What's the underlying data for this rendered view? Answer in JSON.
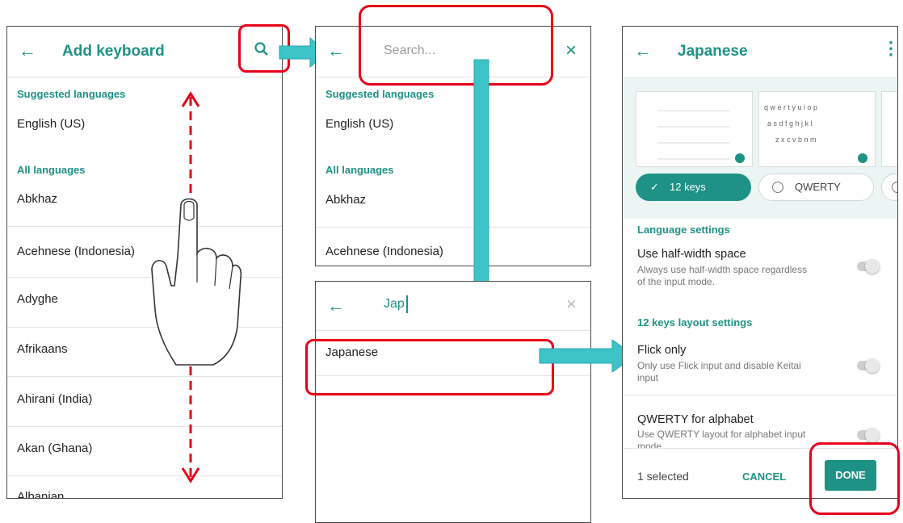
{
  "panel1": {
    "title": "Add keyboard",
    "suggested_header": "Suggested languages",
    "suggested": [
      "English (US)"
    ],
    "all_header": "All languages",
    "languages": [
      "Abkhaz",
      "Acehnese (Indonesia)",
      "Adyghe",
      "Afrikaans",
      "Ahirani (India)",
      "Akan (Ghana)",
      "Albanian"
    ]
  },
  "panel2": {
    "search_placeholder": "Search...",
    "suggested_header": "Suggested languages",
    "suggested": [
      "English (US)"
    ],
    "all_header": "All languages",
    "languages": [
      "Abkhaz",
      "Acehnese (Indonesia)"
    ]
  },
  "panel3": {
    "query": "Jap",
    "result": "Japanese"
  },
  "panel4": {
    "title": "Japanese",
    "layouts": [
      "12 keys",
      "QWERTY"
    ],
    "language_settings_header": "Language settings",
    "half_width_title": "Use half-width space",
    "half_width_desc": "Always use half-width space regardless of the input mode.",
    "twelve_keys_header": "12 keys layout settings",
    "flick_title": "Flick only",
    "flick_desc": "Only use Flick input and disable Keitai input",
    "qwerty_title": "QWERTY for alphabet",
    "qwerty_desc": "Use QWERTY layout for alphabet input mode",
    "selected_count": "1 selected",
    "cancel_label": "CANCEL",
    "done_label": "DONE"
  },
  "colors": {
    "accent": "#1e9285",
    "highlight": "#e8001a",
    "arrow": "#3cc4c8"
  }
}
